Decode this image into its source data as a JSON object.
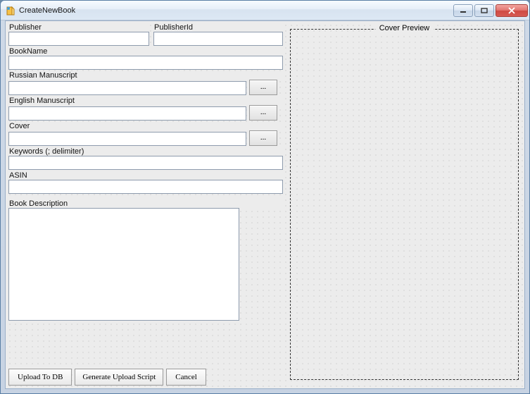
{
  "window": {
    "title": "CreateNewBook"
  },
  "labels": {
    "publisher": "Publisher",
    "publisherId": "PublisherId",
    "bookName": "BookName",
    "russianManuscript": "Russian Manuscript",
    "englishManuscript": "English Manuscript",
    "cover": "Cover",
    "keywords": "Keywords (; delimiter)",
    "asin": "ASIN",
    "bookDescription": "Book Description",
    "coverPreview": "Cover Preview"
  },
  "values": {
    "publisher": "",
    "publisherId": "",
    "bookName": "",
    "russianManuscript": "",
    "englishManuscript": "",
    "cover": "",
    "keywords": "",
    "asin": "",
    "bookDescription": ""
  },
  "buttons": {
    "browse": "...",
    "uploadToDb": "Upload To DB",
    "generateUploadScript": "Generate Upload Script",
    "cancel": "Cancel"
  }
}
